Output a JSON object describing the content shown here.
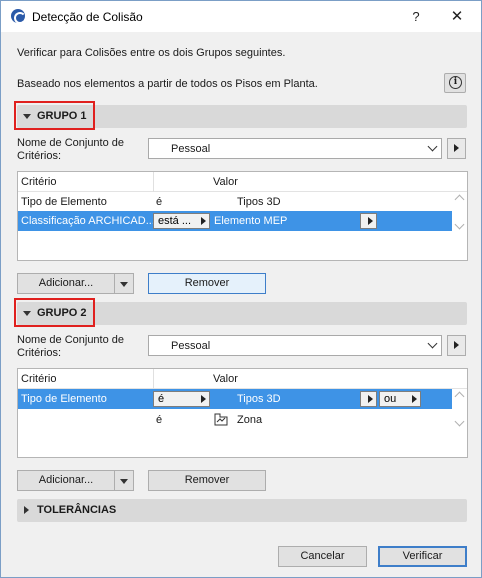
{
  "window": {
    "title": "Detecção de Colisão",
    "help": "?",
    "close": "✕"
  },
  "intro": {
    "line1": "Verificar para Colisões entre os dois Grupos seguintes.",
    "line2": "Baseado nos elementos a partir de todos os Pisos em Planta.",
    "info_icon": "i"
  },
  "group1": {
    "title": "GRUPO 1",
    "criteria_label_1": "Nome de Conjunto de",
    "criteria_label_2": "Critérios:",
    "criteria_value": "Pessoal",
    "columns": {
      "criterion": "Critério",
      "value": "Valor"
    },
    "rows": [
      {
        "criterion": "Tipo de Elemento",
        "operator": "é",
        "value": "Tipos 3D"
      },
      {
        "criterion": "Classificação ARCHICAD...",
        "operator": "está ...",
        "value": "Elemento MEP"
      }
    ],
    "add_label": "Adicionar...",
    "remove_label": "Remover"
  },
  "group2": {
    "title": "GRUPO 2",
    "criteria_label_1": "Nome de Conjunto de",
    "criteria_label_2": "Critérios:",
    "criteria_value": "Pessoal",
    "columns": {
      "criterion": "Critério",
      "value": "Valor"
    },
    "rows": [
      {
        "criterion": "Tipo de Elemento",
        "operator": "é",
        "value": "Tipos 3D",
        "logic": "ou"
      },
      {
        "criterion": "",
        "operator": "é",
        "value": "Zona"
      }
    ],
    "add_label": "Adicionar...",
    "remove_label": "Remover"
  },
  "tolerances": {
    "title": "TOLERÂNCIAS"
  },
  "footer": {
    "cancel": "Cancelar",
    "verify": "Verificar"
  },
  "colors": {
    "selection": "#3e93e6",
    "highlight": "#e0201e",
    "accent": "#3e7ec9"
  }
}
